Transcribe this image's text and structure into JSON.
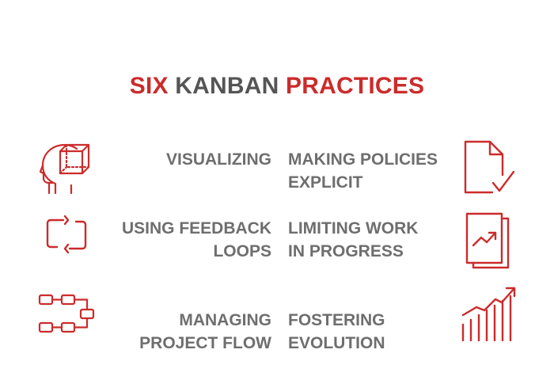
{
  "title": {
    "word1": "SIX",
    "word2": "KANBAN",
    "word3": "PRACTICES"
  },
  "practices": {
    "left": [
      {
        "line1": "VISUALIZING",
        "line2": "",
        "icon": "head-cube-icon"
      },
      {
        "line1": "USING FEEDBACK",
        "line2": "LOOPS",
        "icon": "feedback-loop-icon"
      },
      {
        "line1": "MANAGING",
        "line2": "PROJECT FLOW",
        "icon": "flow-diagram-icon"
      }
    ],
    "right": [
      {
        "line1": "MAKING POLICIES",
        "line2": "EXPLICIT",
        "icon": "document-check-icon"
      },
      {
        "line1": "LIMITING WORK",
        "line2": "IN PROGRESS",
        "icon": "chart-report-icon"
      },
      {
        "line1": "FOSTERING",
        "line2": "EVOLUTION",
        "icon": "growth-bars-icon"
      }
    ]
  },
  "colors": {
    "accent_red": "#cc2b2b",
    "text_gray": "#6e6e6e",
    "title_gray": "#555555",
    "background": "#ffffff"
  }
}
